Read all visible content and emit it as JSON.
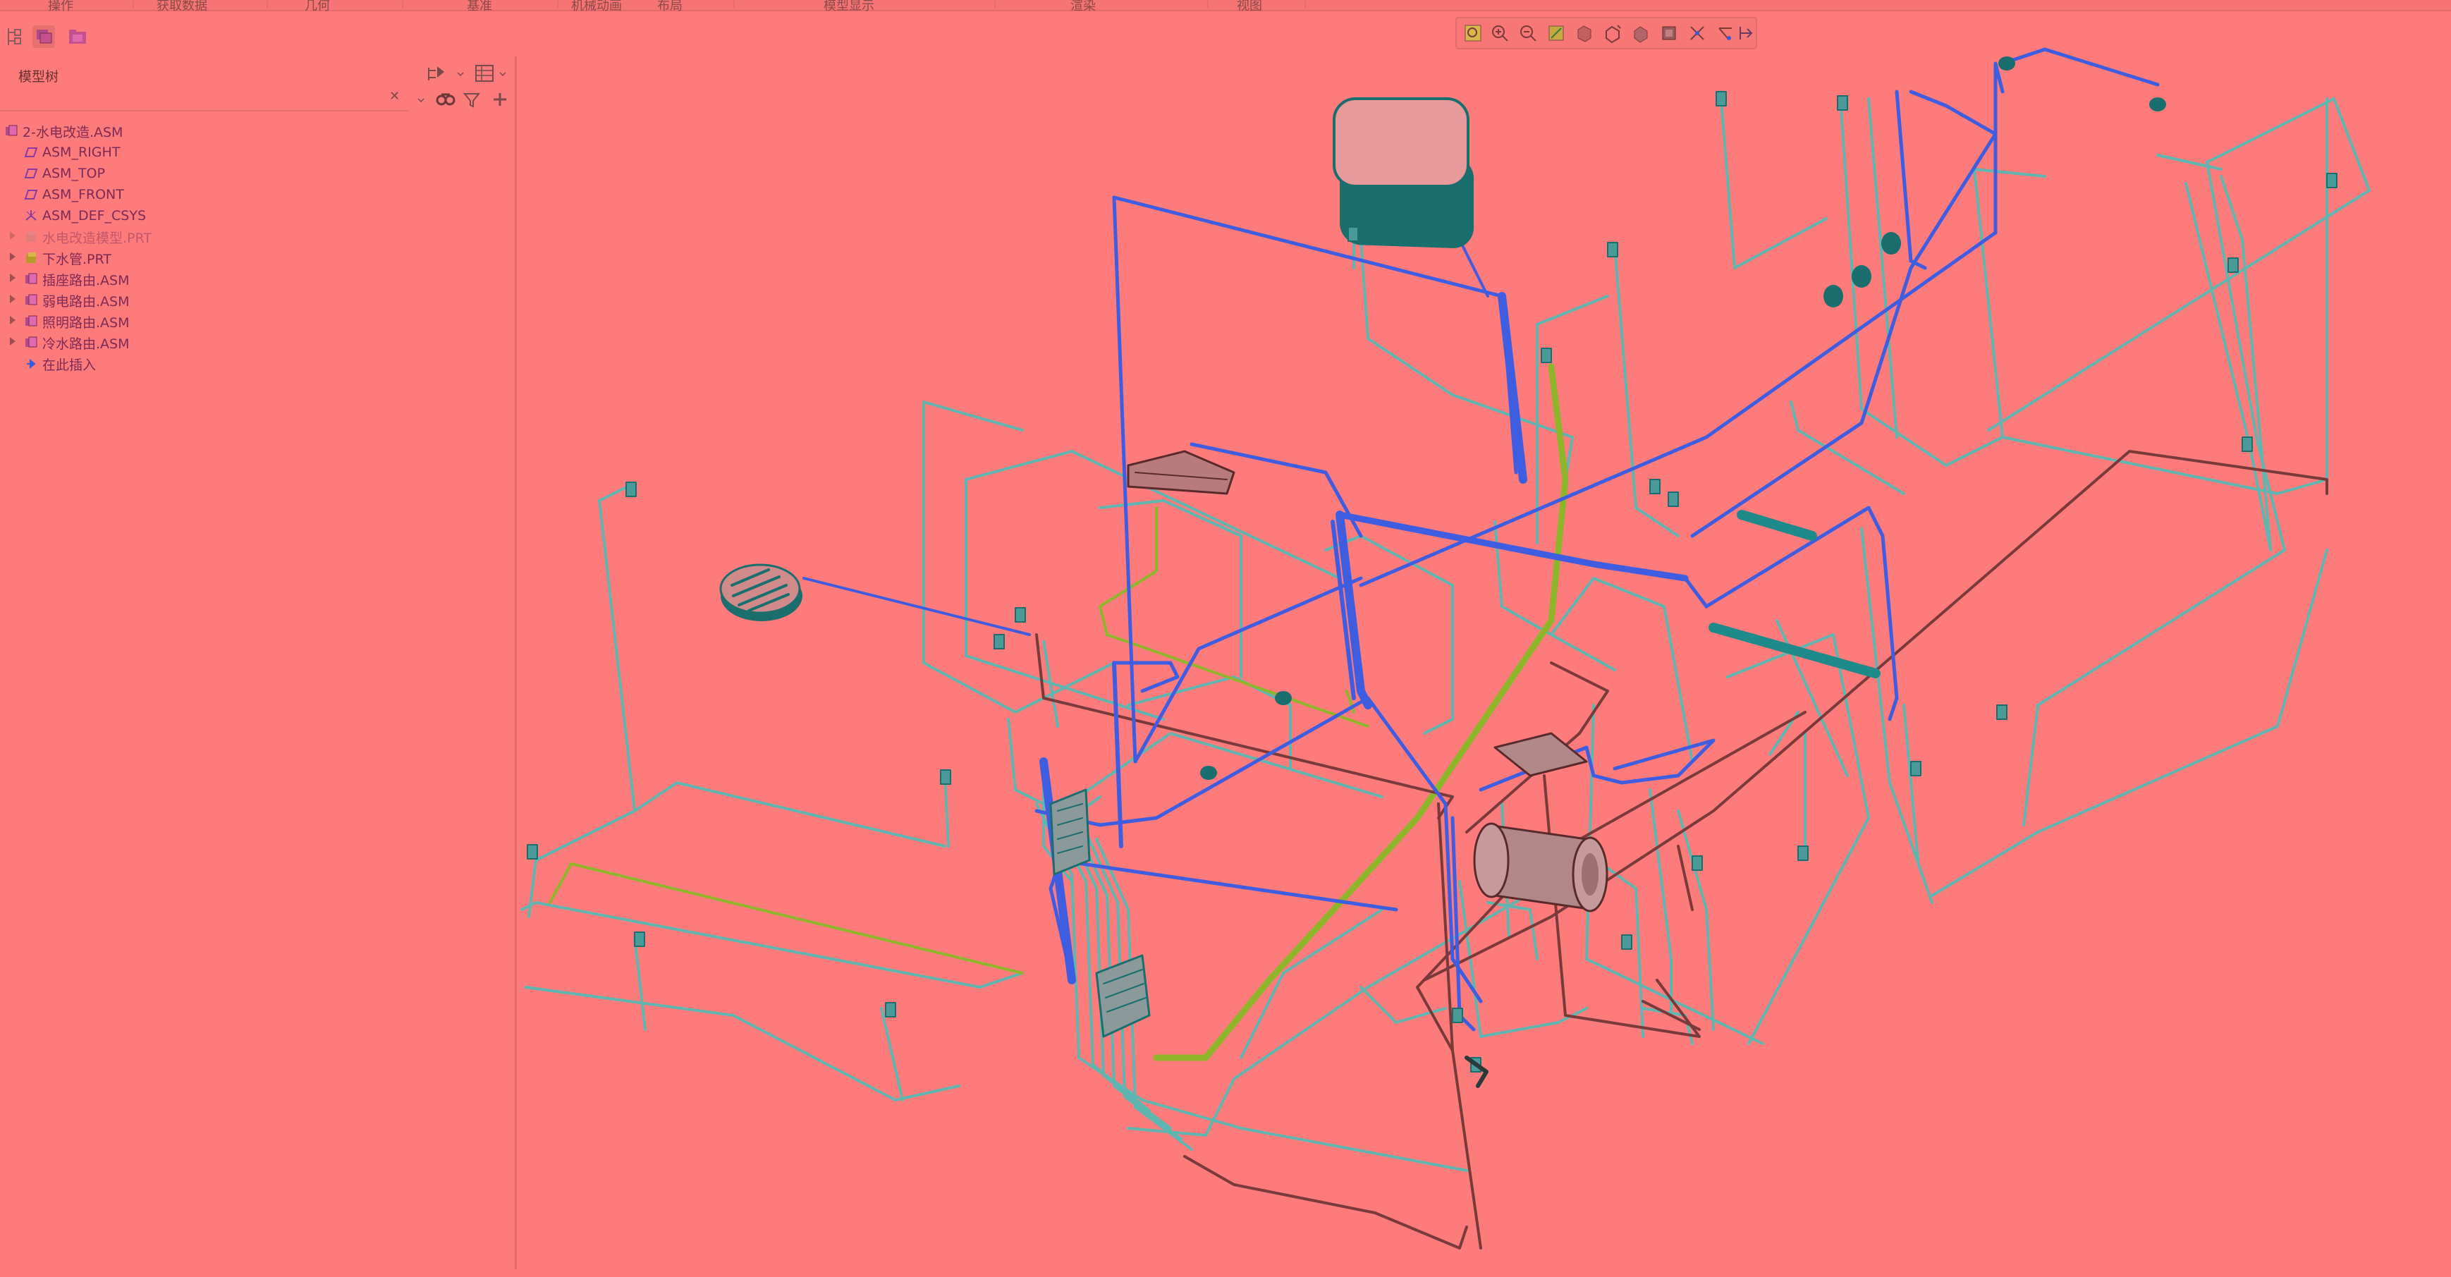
{
  "menubar": {
    "items": [
      "操作",
      "获取数据",
      "几何",
      "基准",
      "机械动画",
      "布局",
      "模型显示",
      "渲染",
      "视图"
    ]
  },
  "model_tree": {
    "title": "模型树",
    "search": {
      "value": "",
      "clear_glyph": "✕"
    },
    "nodes": [
      {
        "label": "2-水电改造.ASM",
        "icon": "assembly-icon",
        "expandable": false
      },
      {
        "label": "ASM_RIGHT",
        "icon": "datum-plane-icon",
        "expandable": false
      },
      {
        "label": "ASM_TOP",
        "icon": "datum-plane-icon",
        "expandable": false
      },
      {
        "label": "ASM_FRONT",
        "icon": "datum-plane-icon",
        "expandable": false
      },
      {
        "label": "ASM_DEF_CSYS",
        "icon": "coordinate-system-icon",
        "expandable": false
      },
      {
        "label": "水电改造模型.PRT",
        "icon": "part-icon",
        "expandable": true,
        "dimmed": true
      },
      {
        "label": "下水管.PRT",
        "icon": "part-icon",
        "expandable": true
      },
      {
        "label": "插座路由.ASM",
        "icon": "assembly-icon",
        "expandable": true
      },
      {
        "label": "弱电路由.ASM",
        "icon": "assembly-icon",
        "expandable": true
      },
      {
        "label": "照明路由.ASM",
        "icon": "assembly-icon",
        "expandable": true
      },
      {
        "label": "冷水路由.ASM",
        "icon": "assembly-icon",
        "expandable": true
      },
      {
        "label": "在此插入",
        "icon": "insert-here-icon",
        "expandable": false
      }
    ]
  },
  "view_toolbar": {
    "buttons": [
      "refit-icon",
      "zoom-in-icon",
      "zoom-out-icon",
      "repaint-icon",
      "display-style-icon",
      "saved-orientations-icon",
      "view-manager-icon",
      "perspective-icon",
      "datum-display-icon",
      "annotation-display-icon",
      "spin-center-icon"
    ]
  },
  "colors": {
    "background": "#fe7b7b",
    "pipe_blue": "#3f5de0",
    "pipe_cyan": "#5fb6b0",
    "pipe_green": "#8fb62a",
    "pipe_dark": "#7a3a3a",
    "teal": "#1f8a8a"
  }
}
